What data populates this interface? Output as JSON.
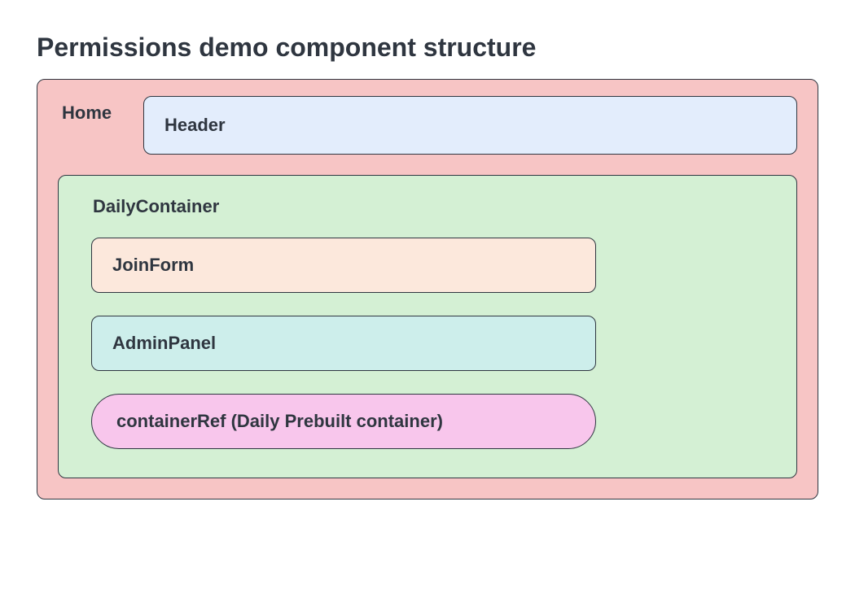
{
  "title": "Permissions demo component structure",
  "home": {
    "label": "Home",
    "header": {
      "label": "Header"
    },
    "dailyContainer": {
      "label": "DailyContainer",
      "joinForm": {
        "label": "JoinForm"
      },
      "adminPanel": {
        "label": "AdminPanel"
      },
      "containerRef": {
        "label": "containerRef (Daily Prebuilt container)"
      }
    }
  }
}
